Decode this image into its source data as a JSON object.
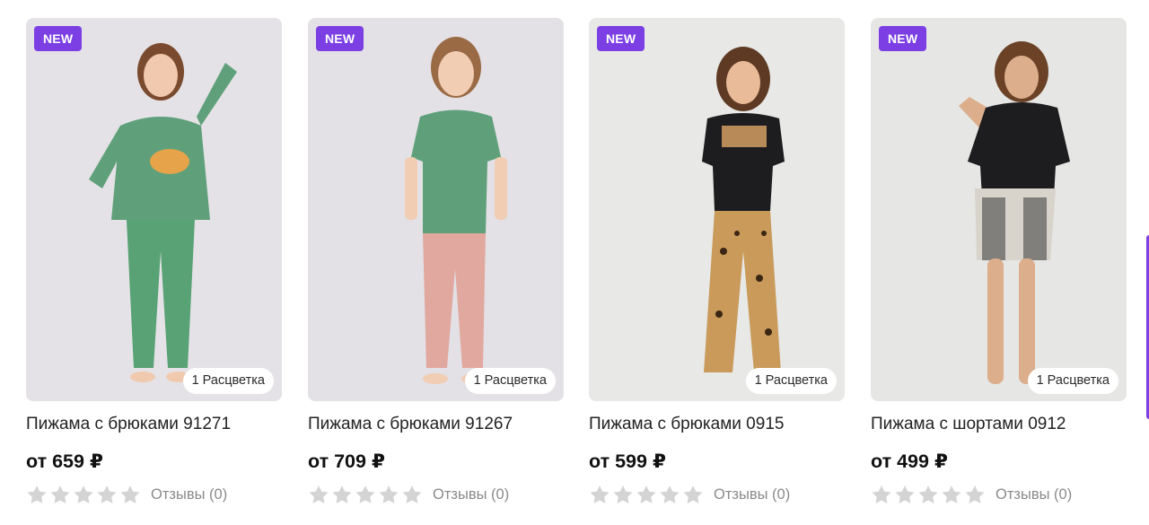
{
  "products": [
    {
      "badge": "NEW",
      "colors_label": "1 Расцветка",
      "title": "Пижама с брюками 91271",
      "price": "от 659 ₽",
      "rating": 0,
      "reviews": "Отзывы (0)",
      "top_color": "#5fa07a",
      "bottom_color": "#5fa07a"
    },
    {
      "badge": "NEW",
      "colors_label": "1 Расцветка",
      "title": "Пижама с брюками 91267",
      "price": "от 709 ₽",
      "rating": 0,
      "reviews": "Отзывы (0)",
      "top_color": "#5fa07a",
      "bottom_color": "#e1a8a0"
    },
    {
      "badge": "NEW",
      "colors_label": "1 Расцветка",
      "title": "Пижама с брюками 0915",
      "price": "от 599 ₽",
      "rating": 0,
      "reviews": "Отзывы (0)",
      "top_color": "#1d1d1f",
      "bottom_color": "#c99a5a"
    },
    {
      "badge": "NEW",
      "colors_label": "1 Расцветка",
      "title": "Пижама с шортами 0912",
      "price": "от 499 ₽",
      "rating": 0,
      "reviews": "Отзывы (0)",
      "top_color": "#1d1d1f",
      "bottom_color": "#d8d3cb"
    }
  ],
  "colors": {
    "badge_bg": "#7b3fe4",
    "star_empty": "#d4d4d4",
    "photo_bg": "#e6e4e6"
  }
}
